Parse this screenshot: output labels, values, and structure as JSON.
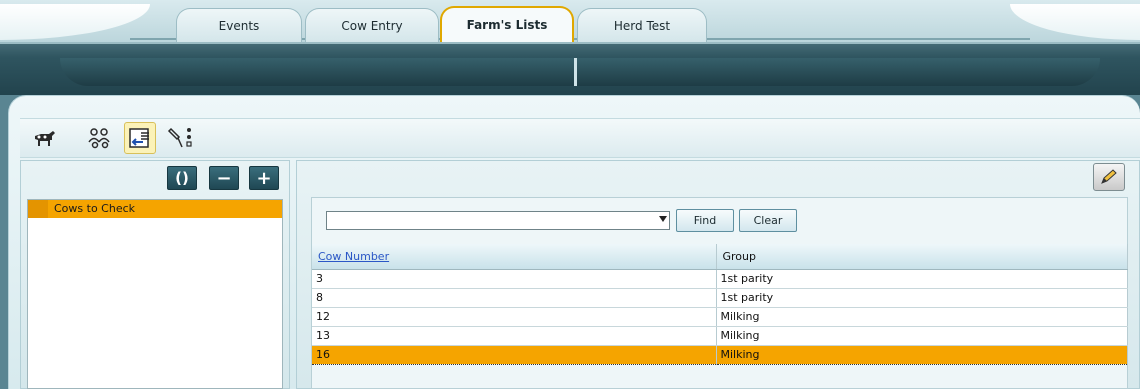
{
  "tabs": [
    {
      "label": "Events"
    },
    {
      "label": "Cow Entry"
    },
    {
      "label": "Farm's Lists"
    },
    {
      "label": "Herd Test"
    }
  ],
  "toolbar": {
    "tools": [
      {
        "icon": "cow-events-icon"
      },
      {
        "icon": "people-groups-icon"
      },
      {
        "icon": "list-import-icon"
      },
      {
        "icon": "probe-filter-icon"
      }
    ],
    "active_tool_index": 2
  },
  "left_panel": {
    "buttons": [
      {
        "icon": "refresh-icon",
        "label": "()"
      },
      {
        "icon": "remove-icon",
        "label": "−"
      },
      {
        "icon": "add-icon",
        "label": "+"
      }
    ],
    "lists": [
      {
        "label": "Cows to Check",
        "selected": true
      }
    ]
  },
  "right_panel": {
    "edit_icon": "pencil-icon",
    "search": {
      "value": "",
      "find_label": "Find",
      "clear_label": "Clear"
    },
    "table": {
      "columns": [
        "Cow Number",
        "Group"
      ],
      "rows": [
        {
          "cow_number": "3",
          "group": "1st parity"
        },
        {
          "cow_number": "8",
          "group": "1st parity"
        },
        {
          "cow_number": "12",
          "group": "Milking"
        },
        {
          "cow_number": "13",
          "group": "Milking"
        },
        {
          "cow_number": "16",
          "group": "Milking"
        }
      ],
      "selected_row_index": 4
    }
  },
  "colors": {
    "accent_selected": "#f5a400",
    "active_tab_border": "#e0a800",
    "dark_band": "#1e3c45"
  }
}
